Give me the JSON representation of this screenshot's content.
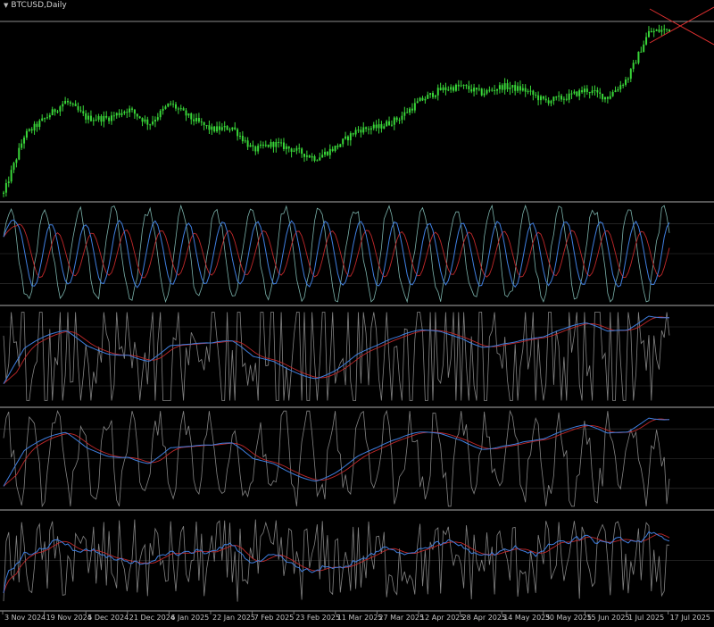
{
  "symbol_title": "BTCUSD,Daily",
  "colors": {
    "background": "#000000",
    "candle": "#39d639",
    "separator": "#8a8a8a",
    "level": "#3a3a3a",
    "fast": "#8fd0c8",
    "blue": "#3f7fe0",
    "red": "#c0282a",
    "grey": "#9a9a9a",
    "cursor": "#e03030"
  },
  "chart_data": [
    {
      "type": "line",
      "name": "price",
      "x_axis": [
        "3 Nov 2024",
        "19 Nov 2024",
        "5 Dec 2024",
        "21 Dec 2024",
        "6 Jan 2025",
        "22 Jan 2025",
        "7 Feb 2025",
        "23 Feb 2025",
        "11 Mar 2025",
        "27 Mar 2025",
        "12 Apr 2025",
        "28 Apr 2025",
        "14 May 2025",
        "30 May 2025",
        "15 Jun 2025",
        "1 Jul 2025",
        "17 Jul 2025"
      ],
      "x_days": [
        0,
        16,
        32,
        48,
        64,
        80,
        96,
        112,
        128,
        144,
        160,
        176,
        192,
        208,
        224,
        240,
        256
      ],
      "close_trend": [
        0.04,
        0.55,
        0.7,
        0.85,
        0.7,
        0.7,
        0.78,
        0.65,
        0.83,
        0.7,
        0.6,
        0.62,
        0.42,
        0.48,
        0.42,
        0.35,
        0.45,
        0.6,
        0.62,
        0.7,
        0.85,
        0.95,
        0.98,
        0.92,
        0.98,
        0.95,
        0.85,
        0.88,
        0.95,
        0.88,
        1.05,
        1.45,
        1.48
      ]
    },
    {
      "type": "line",
      "name": "oscillator-1",
      "ylim": [
        0,
        100
      ],
      "levels": [
        20,
        50,
        80
      ]
    },
    {
      "type": "line",
      "name": "oscillator-2",
      "ylim": [
        0,
        100
      ],
      "levels": [
        20,
        80
      ]
    },
    {
      "type": "line",
      "name": "oscillator-3",
      "ylim": [
        0,
        100
      ],
      "levels": [
        20,
        50,
        80
      ]
    },
    {
      "type": "line",
      "name": "oscillator-4",
      "ylim": [
        0,
        100
      ],
      "levels": [
        50
      ]
    }
  ]
}
